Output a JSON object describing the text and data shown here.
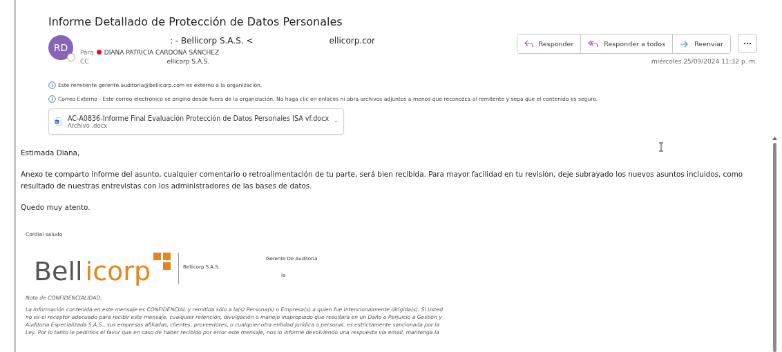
{
  "email": {
    "subject": "Informe Detallado de Protección de Datos Personales",
    "avatar": {
      "initials": "RD",
      "presence": false
    },
    "sender": {
      "name_fragment": ": - Bellicorp S.A.S. <",
      "address_fragment": "ellicorp.cor"
    },
    "to": {
      "label": "Para",
      "name": "DIANA PATRICIA CARDONA SÁNCHEZ",
      "color": "#e0102a"
    },
    "cc": {
      "label": "CC",
      "name_fragment": "ellicorp S.A.S."
    },
    "actions": [
      {
        "kind": "reply",
        "label": "Responder"
      },
      {
        "kind": "reply_all",
        "label": "Responder a todos"
      },
      {
        "kind": "forward",
        "label": "Reenviar"
      }
    ],
    "more": "···",
    "date": "miércoles 25/09/2024 11:32 p. m.",
    "notices": [
      "Este remitente gerente.auditoria@bellicorp.com es externo a la organización.",
      "Correo Externo - Este correo electrónico se originó desde fuera de la organización. No haga clic en enlaces ni abra archivos adjuntos a menos que reconozca al remitente y sepa que el contenido es seguro."
    ],
    "attachment": {
      "name": "AC-A0836-Informe Final Evaluación Protección de Datos Personales ISA vf.docx",
      "type": "Archivo .docx"
    },
    "body": [
      "Estimada Diana,",
      "Anexo te comparto informe del asunto, cualquier comentario o retroalimentación de tu parte, será bien recibida. Para mayor facilidad en tu revisión, deje subrayado los nuevos asuntos incluidos, como resultado de nuestras entrevistas con los administradores de las bases de datos.",
      "Quedo muy atento."
    ],
    "signature": {
      "greeting": "Cordial saludo",
      "logo": [
        "Bell",
        "icorp"
      ],
      "role": "Gerente De Auditoria",
      "company": "Bellicorp S.A.S.",
      "line_fragment": "ia",
      "note_title": "Nota de CONFIDENCIALIDAD:",
      "note_lines": [
        "La Información contenida en este mensaje es CONFIDENCIAL y remitida sólo a la(s) Persona(s) o Empresa(s) a quien fue intencionalmente dirigida(s).  Si Usted",
        "no es el receptor adecuado para recibir este mensaje, cualquier retención, divulgación o manejo inapropiado que resultara en un Daño o Perjuicio a Gestión y",
        "Auditoria Especializada S.A.S., sus empresas afiliadas, clientes, proveedores, o cualquier otra entidad jurídica o personal, es estrictamente sancionada por la",
        "Ley.  Por lo tanto le pedimos el favor que en caso de haber recibido por error este mensaje, nos lo informe devolviendo una respuesta vía email, mantenga la"
      ]
    }
  }
}
